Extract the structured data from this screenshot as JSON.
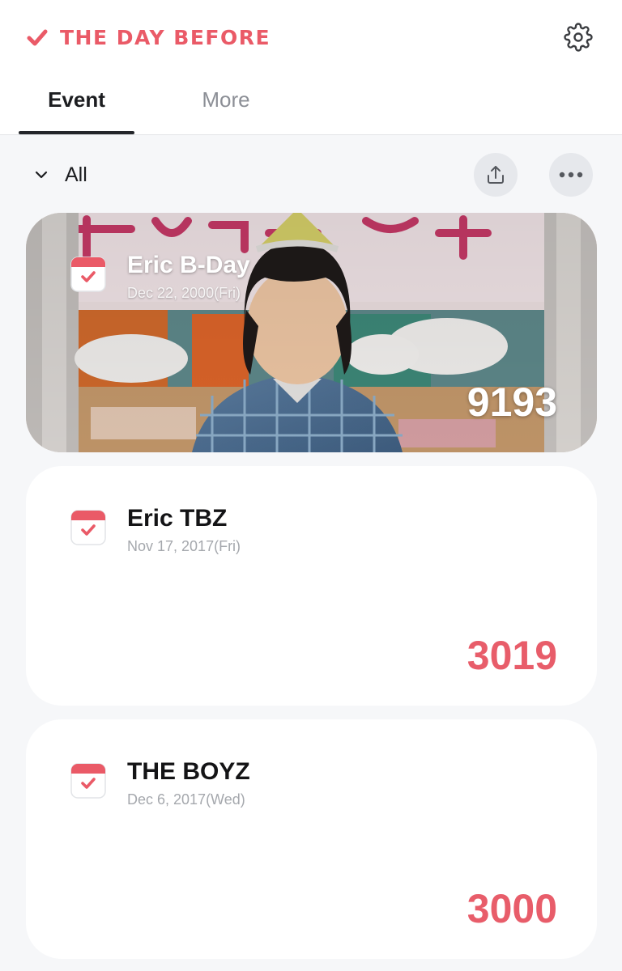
{
  "app": {
    "title": "THE DAY BEFORE",
    "brand_color": "#ea5a67",
    "logo_icon": "check-icon",
    "settings_icon": "gear-icon"
  },
  "tabs": [
    {
      "label": "Event",
      "active": true
    },
    {
      "label": "More",
      "active": false
    }
  ],
  "filter": {
    "label": "All",
    "icon": "chevron-down-icon"
  },
  "actions": {
    "share_icon": "share-icon",
    "more_icon": "ellipsis-icon"
  },
  "events": [
    {
      "title": "Eric B-Day",
      "date": "Dec 22, 2000(Fri)",
      "count": "9193",
      "has_photo": true,
      "icon": "calendar-check-icon"
    },
    {
      "title": "Eric TBZ",
      "date": "Nov 17, 2017(Fri)",
      "count": "3019",
      "has_photo": false,
      "icon": "calendar-check-icon"
    },
    {
      "title": "THE BOYZ",
      "date": "Dec 6, 2017(Wed)",
      "count": "3000",
      "has_photo": false,
      "icon": "calendar-check-icon"
    }
  ]
}
